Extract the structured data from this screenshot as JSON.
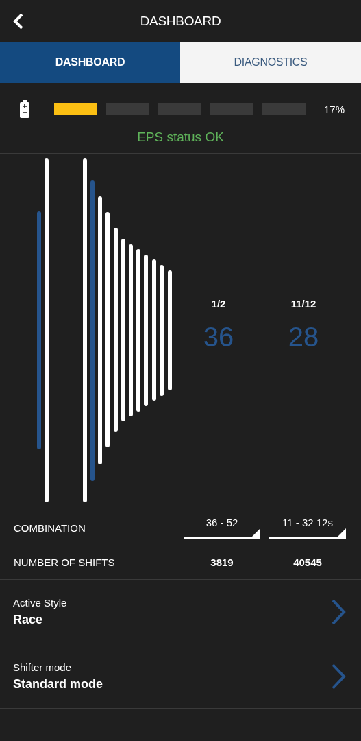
{
  "header": {
    "title": "DASHBOARD"
  },
  "tabs": [
    {
      "label": "DASHBOARD",
      "selected": true
    },
    {
      "label": "DIAGNOSTICS",
      "selected": false
    }
  ],
  "battery": {
    "level": 0.17,
    "reading": "17%"
  },
  "status": "EPS status OK",
  "gears": [
    {
      "position": "1/2",
      "teeth": "36"
    },
    {
      "position": "11/12",
      "teeth": "28"
    }
  ],
  "combination": {
    "label": "COMBINATION",
    "values": [
      "36 - 52",
      "11 - 32 12s"
    ]
  },
  "shifts": {
    "label": "NUMBER OF SHIFTS",
    "values": [
      "3819",
      "40545"
    ]
  },
  "settings": [
    {
      "label": "Active Style",
      "value": "Race"
    },
    {
      "label": "Shifter mode",
      "value": "Standard mode"
    }
  ]
}
